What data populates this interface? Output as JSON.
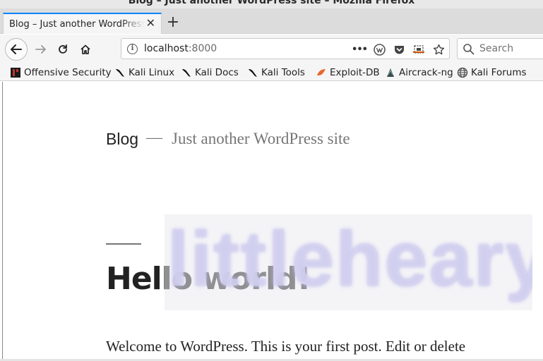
{
  "window": {
    "title": "Blog – Just another WordPress site – Mozilla Firefox"
  },
  "tab": {
    "title": "Blog – Just another WordPress site",
    "close": "✕",
    "new_tab": "+"
  },
  "navbar": {
    "url_host": "localhost",
    "url_port": ":8000",
    "page_actions": "•••",
    "search_placeholder": "Search"
  },
  "bookmarks": [
    {
      "label": "Offensive Security",
      "icon": "offsec-icon"
    },
    {
      "label": "Kali Linux",
      "icon": "kali-dragon-icon"
    },
    {
      "label": "Kali Docs",
      "icon": "kali-dragon-icon"
    },
    {
      "label": "Kali Tools",
      "icon": "kali-dragon-icon"
    },
    {
      "label": "Exploit-DB",
      "icon": "exploit-db-icon"
    },
    {
      "label": "Aircrack-ng",
      "icon": "aircrack-icon"
    },
    {
      "label": "Kali Forums",
      "icon": "globe-icon"
    }
  ],
  "page": {
    "site_title": "Blog",
    "separator": "—",
    "site_description": "Just another WordPress site",
    "post_title": "Hello world!",
    "post_excerpt": "Welcome to WordPress. This is your first post. Edit or delete"
  },
  "watermark": {
    "text": "littleheary"
  },
  "colors": {
    "tab_accent": "#0a84ff",
    "text": "#222222",
    "muted": "#767676"
  }
}
